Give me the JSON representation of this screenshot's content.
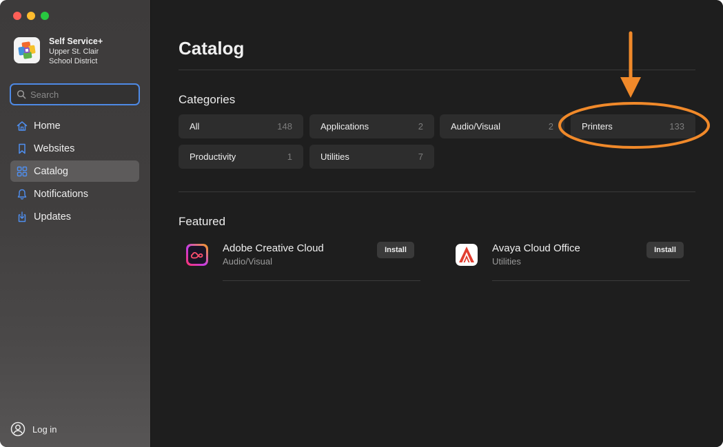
{
  "app": {
    "name": "Self Service+",
    "org_line1": "Upper St. Clair",
    "org_line2": "School District"
  },
  "search": {
    "placeholder": "Search",
    "value": ""
  },
  "sidebar": {
    "items": [
      {
        "label": "Home",
        "icon": "home-icon",
        "active": false
      },
      {
        "label": "Websites",
        "icon": "bookmark-icon",
        "active": false
      },
      {
        "label": "Catalog",
        "icon": "grid-icon",
        "active": true
      },
      {
        "label": "Notifications",
        "icon": "bell-icon",
        "active": false
      },
      {
        "label": "Updates",
        "icon": "download-icon",
        "active": false
      }
    ],
    "login_label": "Log in"
  },
  "main": {
    "title": "Catalog",
    "categories_heading": "Categories",
    "categories": [
      {
        "label": "All",
        "count": "148"
      },
      {
        "label": "Applications",
        "count": "2"
      },
      {
        "label": "Audio/Visual",
        "count": "2"
      },
      {
        "label": "Printers",
        "count": "133"
      },
      {
        "label": "Productivity",
        "count": "1"
      },
      {
        "label": "Utilities",
        "count": "7"
      }
    ],
    "featured_heading": "Featured",
    "featured": [
      {
        "name": "Adobe Creative Cloud",
        "category": "Audio/Visual",
        "action": "Install",
        "icon": "adobe-cc-icon"
      },
      {
        "name": "Avaya Cloud Office",
        "category": "Utilities",
        "action": "Install",
        "icon": "avaya-icon"
      }
    ]
  },
  "colors": {
    "annotation": "#f0892a",
    "search_focus": "#4e8ae6",
    "sidebar_active": "#5d5b5b"
  }
}
